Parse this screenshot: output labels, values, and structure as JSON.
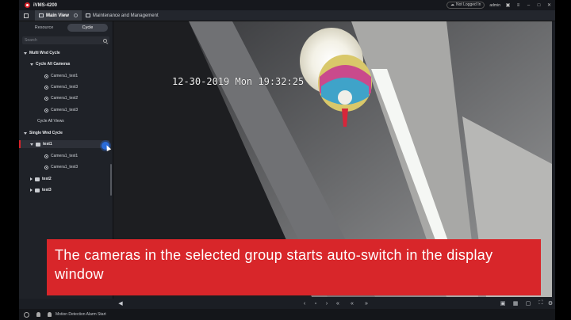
{
  "app": {
    "title": "iVMS-4200",
    "login_status": "Not Logged In",
    "user": "admin",
    "accent_color": "#d8232a"
  },
  "tabs": [
    {
      "label": "Main View",
      "active": true
    },
    {
      "label": "Maintenance and Management",
      "active": false
    }
  ],
  "panel": {
    "tabs": [
      {
        "label": "Resource",
        "active": false
      },
      {
        "label": "Cycle",
        "active": true
      }
    ],
    "search_placeholder": "Search",
    "tree": [
      {
        "label": "Multi Wnd Cycle",
        "level": 0,
        "type": "group",
        "expanded": true
      },
      {
        "label": "Cycle All Cameras",
        "level": 1,
        "type": "group",
        "expanded": true
      },
      {
        "label": "Camera1_test1",
        "level": 2,
        "type": "camera"
      },
      {
        "label": "Camera1_test3",
        "level": 2,
        "type": "camera"
      },
      {
        "label": "Camera1_test2",
        "level": 2,
        "type": "camera"
      },
      {
        "label": "Camera1_test3",
        "level": 2,
        "type": "camera"
      },
      {
        "label": "Cycle All Views",
        "level": 1,
        "type": "item"
      },
      {
        "label": "Single Wnd Cycle",
        "level": 0,
        "type": "group",
        "expanded": true
      },
      {
        "label": "test1",
        "level": 1,
        "type": "folder",
        "expanded": true,
        "selected": true
      },
      {
        "label": "Camera1_test1",
        "level": 2,
        "type": "camera"
      },
      {
        "label": "Camera1_test3",
        "level": 2,
        "type": "camera"
      },
      {
        "label": "test2",
        "level": 1,
        "type": "folder",
        "expanded": false
      },
      {
        "label": "test3",
        "level": 1,
        "type": "folder",
        "expanded": false
      }
    ]
  },
  "video": {
    "osd_timestamp": "12-30-2019 Mon 19:32:25"
  },
  "caption": "The cameras in the selected group starts auto-switch in the display window",
  "controls": {
    "icons": [
      "volume-icon",
      "prev-icon",
      "stop-icon",
      "next-icon",
      "rewind-icon",
      "fast-forward-icon",
      "layout-icon",
      "fullscreen-icon",
      "window-icon",
      "settings-icon"
    ]
  },
  "status": {
    "alarm_text": "Motion Detection Alarm Start"
  }
}
